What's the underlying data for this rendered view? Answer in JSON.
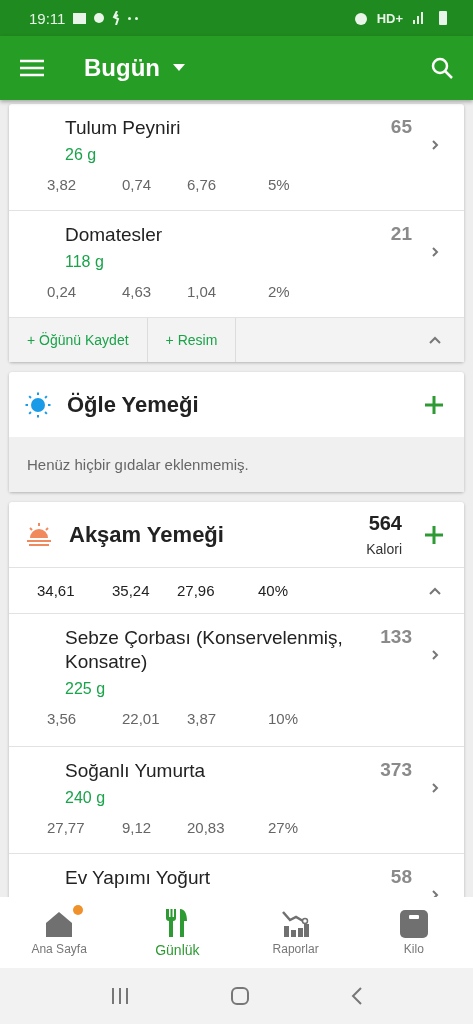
{
  "status_bar": {
    "time": "19:11",
    "network": "HD+"
  },
  "app_bar": {
    "title": "Bugün"
  },
  "meals": [
    {
      "kind": "partial",
      "items": [
        {
          "name": "Tulum Peyniri",
          "amount": "26  g",
          "calories": "65",
          "macros": [
            "3,82",
            "0,74",
            "6,76",
            "5%"
          ]
        },
        {
          "name": "Domatesler",
          "amount": "118  g",
          "calories": "21",
          "macros": [
            "0,24",
            "4,63",
            "1,04",
            "2%"
          ]
        }
      ],
      "actions": [
        "+ Öğünü Kaydet",
        "+ Resim"
      ],
      "expanded": true
    },
    {
      "kind": "lunch",
      "title": "Öğle Yemeği",
      "empty_text": "Henüz hiçbir gıdalar eklenmemiş."
    },
    {
      "kind": "dinner",
      "title": "Akşam Yemeği",
      "calories": "564",
      "calories_label": "Kalori",
      "totals": [
        "34,61",
        "35,24",
        "27,96",
        "40%"
      ],
      "expanded": true,
      "items": [
        {
          "name": "Sebze Çorbası (Konservelenmiş, Konsatre)",
          "amount": "225  g",
          "calories": "133",
          "macros": [
            "3,56",
            "22,01",
            "3,87",
            "10%"
          ]
        },
        {
          "name": "Soğanlı Yumurta",
          "amount": "240  g",
          "calories": "373",
          "macros": [
            "27,77",
            "9,12",
            "20,83",
            "27%"
          ]
        },
        {
          "name": "Ev Yapımı Yoğurt",
          "calories": "58"
        }
      ]
    }
  ],
  "bottom_nav": [
    {
      "label": "Ana Sayfa",
      "kind": "home",
      "selected": false,
      "badge": true
    },
    {
      "label": "Günlük",
      "kind": "food",
      "selected": true,
      "badge": false
    },
    {
      "label": "Raporlar",
      "kind": "chart",
      "selected": false,
      "badge": false
    },
    {
      "label": "Kilo",
      "kind": "scale",
      "selected": false,
      "badge": false
    }
  ]
}
